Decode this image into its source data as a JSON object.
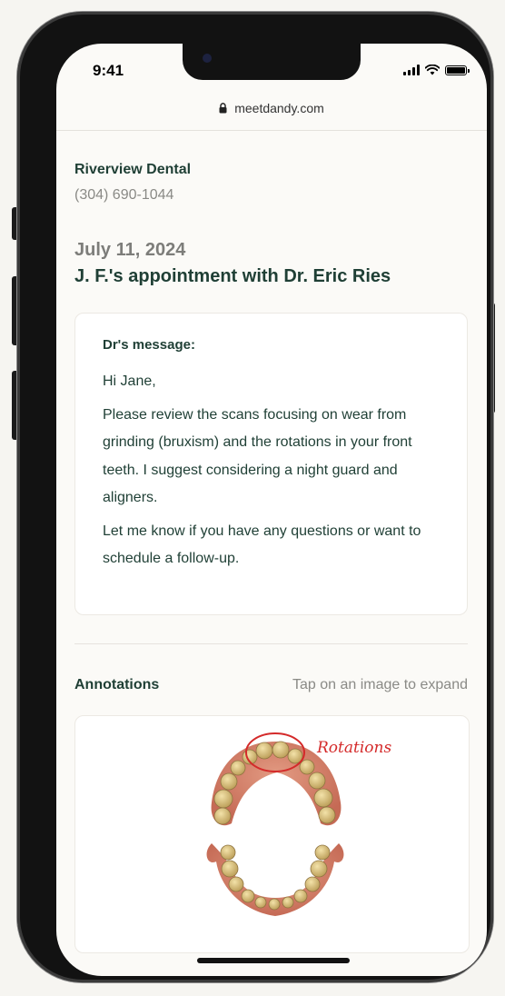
{
  "status_bar": {
    "time": "9:41"
  },
  "browser": {
    "url": "meetdandy.com"
  },
  "clinic": {
    "name": "Riverview Dental",
    "phone": "(304) 690-1044"
  },
  "appointment": {
    "date": "July 11, 2024",
    "title": "J. F.'s appointment with Dr. Eric Ries"
  },
  "message": {
    "heading": "Dr's message:",
    "greeting": "Hi Jane,",
    "paragraph1": "Please review the scans focusing on wear from grinding (bruxism) and the rotations in your front teeth. I suggest considering a night guard and aligners.",
    "paragraph2": "Let me know if you have any questions or want to schedule a follow-up."
  },
  "annotations": {
    "title": "Annotations",
    "hint": "Tap on an image to expand",
    "image_label": "Rotations",
    "annotation_color": "#d42a2a"
  },
  "colors": {
    "brand_text": "#1f3f35",
    "muted_text": "#8a8a86"
  }
}
